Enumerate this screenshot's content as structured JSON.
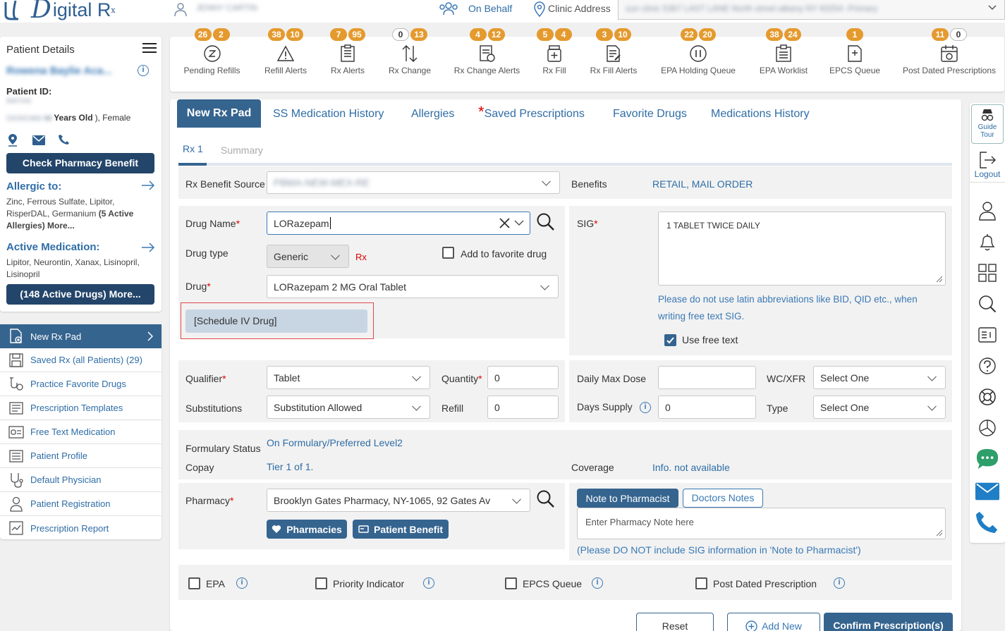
{
  "app": {
    "logo_text": "igital R",
    "logo_sub": "x",
    "user_name": "JENNY CARTIN"
  },
  "header": {
    "on_behalf": "On Behalf",
    "clinic_label": "Clinic Address",
    "clinic_value": "sun clinic 5367 LAST LANE North street albany NY 93254 -Primary"
  },
  "patient": {
    "section_title": "Patient Details",
    "name": "Rowena Baylie Aca...",
    "id_label": "Patient ID:",
    "id_value": "8687046",
    "dob": "03/29/1966",
    "age": "58",
    "age_suffix": "Years Old",
    "gender": "), Female",
    "check_benefit": "Check Pharmacy Benefit",
    "allergic_title": "Allergic to:",
    "allergic_text": "Zinc, Ferrous Sulfate, Lipitor, RisperDAL, Germanium",
    "allergic_bold": "(5 Active Allergies) More...",
    "active_med_title": "Active Medication:",
    "active_med_text": "Lipitor, Neurontin, Xanax, Lisinopril, Lisinopril",
    "active_drugs_btn": "(148 Active Drugs) More..."
  },
  "menu": [
    {
      "label": "New Rx Pad",
      "icon": "new-rx-icon"
    },
    {
      "label": "Saved Rx (all Patients) (29)",
      "icon": "saved-rx-icon"
    },
    {
      "label": "Practice Favorite Drugs",
      "icon": "favorite-drugs-icon"
    },
    {
      "label": "Prescription Templates",
      "icon": "templates-icon"
    },
    {
      "label": "Free Text Medication",
      "icon": "free-text-icon"
    },
    {
      "label": "Patient Profile",
      "icon": "profile-icon"
    },
    {
      "label": "Default Physician",
      "icon": "stethoscope-icon"
    },
    {
      "label": "Patient Registration",
      "icon": "registration-icon"
    },
    {
      "label": "Prescription Report",
      "icon": "report-icon"
    }
  ],
  "queues": [
    {
      "label": "Pending Refills",
      "b1": "26",
      "b2": "2"
    },
    {
      "label": "Refill Alerts",
      "b1": "38",
      "b2": "10"
    },
    {
      "label": "Rx Alerts",
      "b1": "7",
      "b2": "95"
    },
    {
      "label": "Rx Change",
      "b1": "0",
      "b2": "13"
    },
    {
      "label": "Rx Change Alerts",
      "b1": "4",
      "b2": "12"
    },
    {
      "label": "Rx Fill",
      "b1": "5",
      "b2": "4"
    },
    {
      "label": "Rx Fill Alerts",
      "b1": "3",
      "b2": "10"
    },
    {
      "label": "EPA Holding Queue",
      "b1": "22",
      "b2": "20"
    },
    {
      "label": "EPA Worklist",
      "b1": "38",
      "b2": "24"
    },
    {
      "label": "EPCS Queue",
      "b1": "1",
      "b2": ""
    },
    {
      "label": "Post Dated Prescriptions",
      "b1": "11",
      "b2": "0"
    }
  ],
  "tabs": [
    "New Rx Pad",
    "SS Medication History",
    "Allergies",
    "Saved Prescriptions",
    "Favorite Drugs",
    "Medications History"
  ],
  "subtabs": {
    "rx1": "Rx 1",
    "summary": "Summary"
  },
  "form": {
    "benefit_source_label": "Rx Benefit Source",
    "benefit_source_value": "PBMA-NEW-MEX-RE",
    "benefits_label": "Benefits",
    "benefits_value": "RETAIL, MAIL ORDER",
    "drug_name_label": "Drug Name",
    "drug_name_value": "LORazepam",
    "drug_type_label": "Drug type",
    "drug_type_value": "Generic",
    "rx_tag": "Rx",
    "add_favorite": "Add to favorite drug",
    "drug_label": "Drug",
    "drug_value": "LORazepam 2 MG Oral Tablet",
    "schedule": "[Schedule IV Drug]",
    "sig_label": "SIG",
    "sig_value": "1 TABLET TWICE DAILY",
    "sig_warning": "Please do not use latin abbreviations like BID, QID etc., when writing free text SIG.",
    "use_free_text": "Use free text",
    "qualifier_label": "Qualifier",
    "qualifier_value": "Tablet",
    "quantity_label": "Quantity",
    "quantity_value": "0",
    "substitutions_label": "Substitutions",
    "substitutions_value": "Substitution Allowed",
    "refill_label": "Refill",
    "refill_value": "0",
    "daily_max_label": "Daily Max Dose",
    "daily_max_value": "",
    "wc_label": "WC/XFR",
    "wc_value": "Select One",
    "days_supply_label": "Days Supply",
    "days_supply_value": "0",
    "type_label": "Type",
    "type_value": "Select One",
    "formulary_label": "Formulary Status",
    "formulary_value": "On Formulary/Preferred Level2",
    "copay_label": "Copay",
    "copay_value": "Tier 1 of 1.",
    "coverage_label": "Coverage",
    "coverage_value": "Info. not available",
    "pharmacy_label": "Pharmacy",
    "pharmacy_value": "Brooklyn Gates Pharmacy, NY-1065, 92 Gates Av",
    "pharmacies_btn": "Pharmacies",
    "patient_benefit_btn": "Patient Benefit",
    "note_tab": "Note to Pharmacist",
    "doctors_tab": "Doctors Notes",
    "note_placeholder": "Enter Pharmacy Note here",
    "note_warning": "(Please DO NOT include SIG information in 'Note to Pharmacist')",
    "epa": "EPA",
    "priority": "Priority Indicator",
    "epcs": "EPCS Queue",
    "post_dated": "Post Dated Prescription",
    "reset": "Reset",
    "add_new": "Add New",
    "confirm": "Confirm Prescription(s)"
  },
  "rail": {
    "guide_tour": "Guide Tour",
    "logout": "Logout"
  }
}
